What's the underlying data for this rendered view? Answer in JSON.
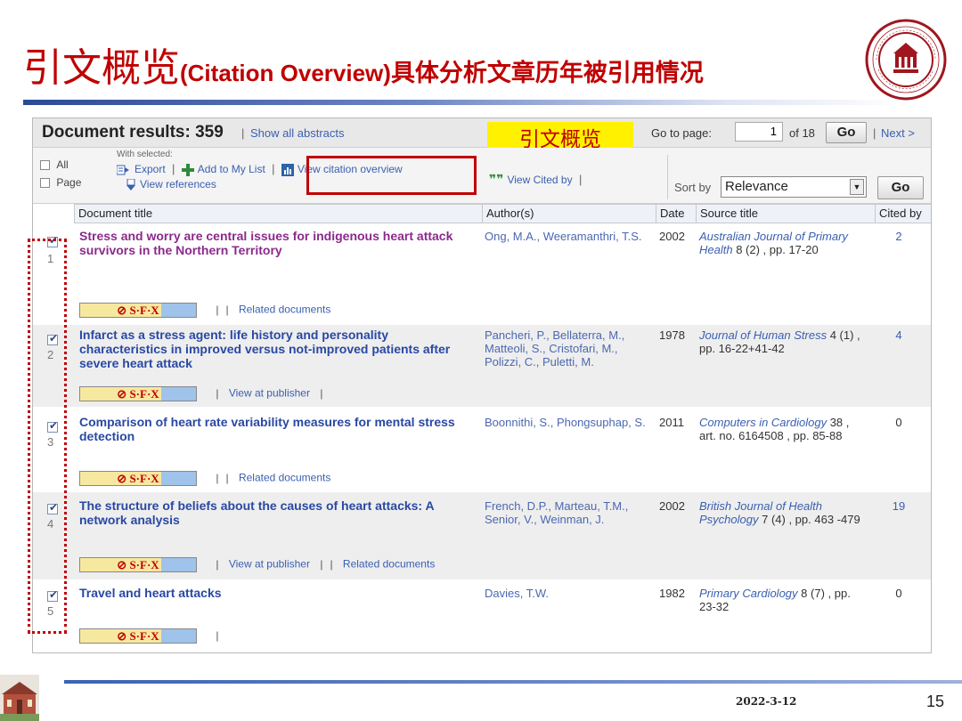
{
  "slide": {
    "title_cn_large": "引文概览",
    "title_en": "(Citation Overview)",
    "title_cn_rest": "具体分析文章历年被引用情况",
    "callout": "引文概览",
    "date": "2022-3-12",
    "page_number": "15"
  },
  "header": {
    "document_results": "Document results: 359",
    "separator": "|",
    "show_all_abstracts": "Show all abstracts",
    "go_to_page": "Go to page:",
    "page_value": "1",
    "of_pages": "of 18",
    "go": "Go",
    "next": "Next >"
  },
  "toolbar": {
    "all": "All",
    "page": "Page",
    "with_selected": "With selected:",
    "export": "Export",
    "add_to_my_list": "Add to My List",
    "view_citation_overview": "View citation overview",
    "view_cited_by": "View Cited by",
    "view_references": "View references",
    "sort_by": "Sort by",
    "sort_value": "Relevance",
    "go": "Go"
  },
  "columns": [
    "Document title",
    "Author(s)",
    "Date",
    "Source title",
    "Cited by"
  ],
  "rows": [
    {
      "num": "1",
      "title": "Stress and worry are central issues for indigenous heart attack survivors in the Northern Territory",
      "authors": "Ong, M.A., Weeramanthri, T.S.",
      "date": "2002",
      "source_journal": "Australian Journal of Primary Health",
      "source_rest": "8 (2) , pp. 17-20",
      "cited_by": "2",
      "sfx": "S·F·X",
      "link1": "",
      "link2": "Related documents"
    },
    {
      "num": "2",
      "title": "Infarct as a stress agent: life history and personality characteristics in improved versus not-improved patients after severe heart attack",
      "authors": "Pancheri, P., Bellaterra, M., Matteoli, S., Cristofari, M., Polizzi, C., Puletti, M.",
      "date": "1978",
      "source_journal": "Journal of Human Stress",
      "source_rest": "4 (1) , pp. 16-22+41-42",
      "cited_by": "4",
      "sfx": "S·F·X",
      "link1": "View at publisher",
      "link2": ""
    },
    {
      "num": "3",
      "title": "Comparison of heart rate variability measures for mental stress detection",
      "authors": "Boonnithi, S., Phongsuphap, S.",
      "date": "2011",
      "source_journal": "Computers in Cardiology",
      "source_rest": "38 , art. no. 6164508 , pp. 85-88",
      "cited_by": "0",
      "sfx": "S·F·X",
      "link1": "",
      "link2": "Related documents"
    },
    {
      "num": "4",
      "title": "The structure of beliefs about the causes of heart attacks: A network analysis",
      "authors": "French, D.P., Marteau, T.M., Senior, V., Weinman, J.",
      "date": "2002",
      "source_journal": "British Journal of Health Psychology",
      "source_rest": "7 (4) , pp. 463 -479",
      "cited_by": "19",
      "sfx": "S·F·X",
      "link1": "View at publisher",
      "link2": "Related documents"
    },
    {
      "num": "5",
      "title": "Travel and heart attacks",
      "authors": "Davies, T.W.",
      "date": "1982",
      "source_journal": "Primary Cardiology",
      "source_rest": "8 (7) , pp. 23-32",
      "cited_by": "0",
      "sfx": "S·F·X",
      "link1": "",
      "link2": ""
    }
  ],
  "colors": {
    "title_red": "#C00000",
    "link_blue": "#3a5fb0",
    "callout_yellow": "#fff100"
  }
}
